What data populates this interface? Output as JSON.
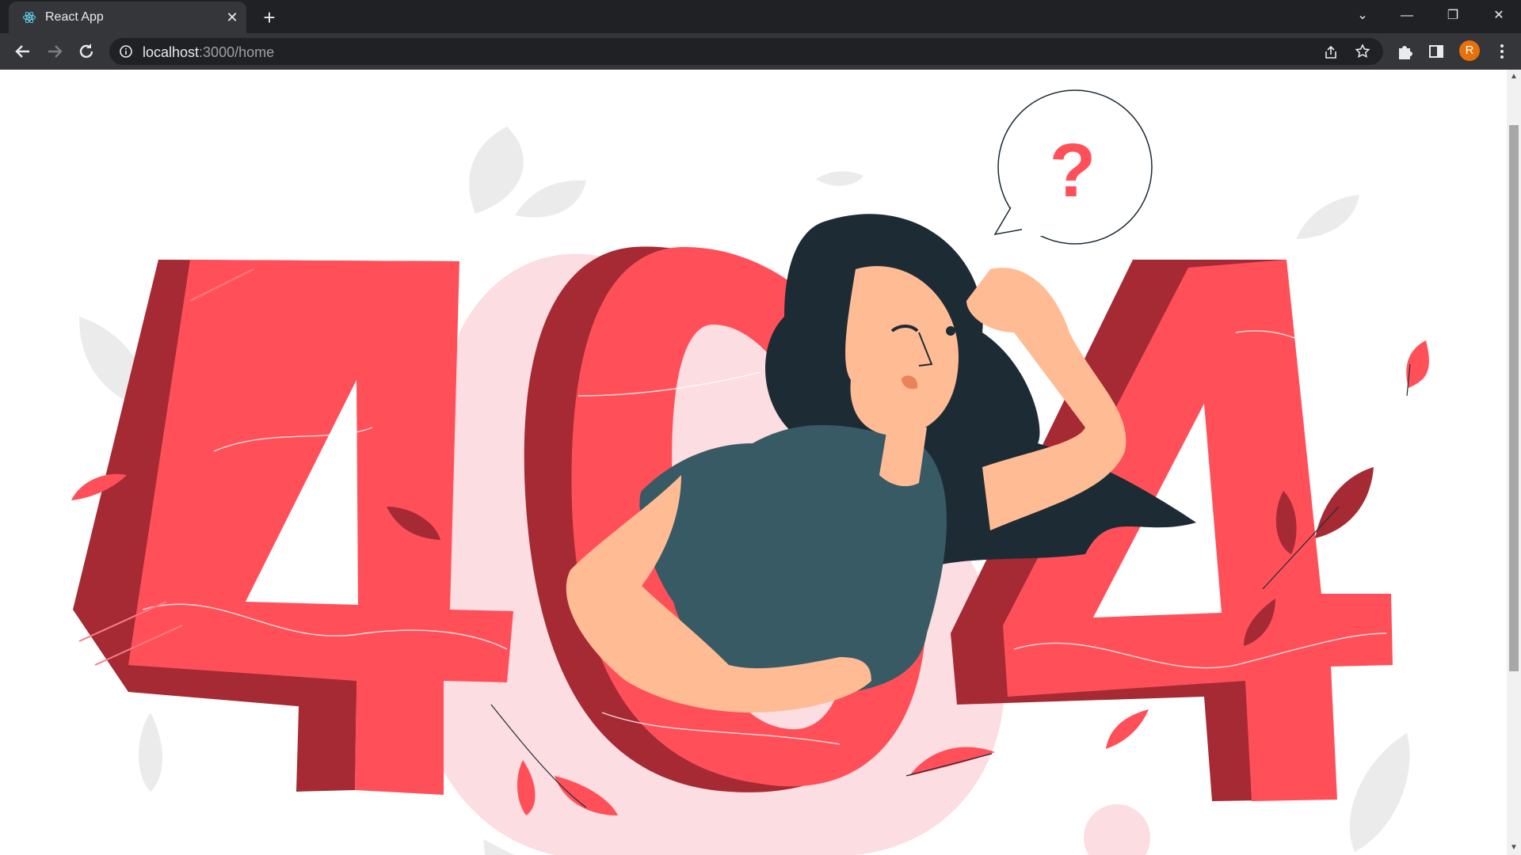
{
  "browser": {
    "tab_title": "React App",
    "close_tab_symbol": "✕",
    "new_tab_symbol": "+",
    "url_host": "localhost",
    "url_path": ":3000/home",
    "avatar_initial": "R",
    "window_controls": {
      "dropdown": "⌄",
      "minimize": "—",
      "restore": "❐",
      "close": "✕"
    }
  },
  "illustration": {
    "big_text": [
      "4",
      "0",
      "4"
    ],
    "speech_symbol": "?",
    "colors": {
      "red": "#ff5059",
      "dark_red": "#a52a34",
      "pink": "#fcdde1",
      "leaf_gray": "#ebebeb",
      "skin": "#ffbc94",
      "hair": "#1d2b35",
      "shirt": "#385a64"
    }
  }
}
